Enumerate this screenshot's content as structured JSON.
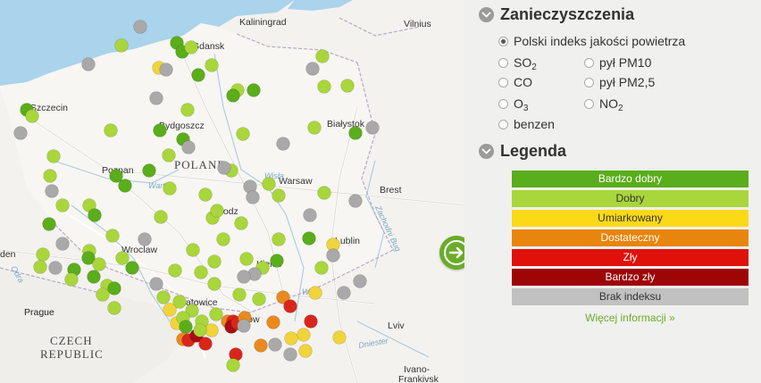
{
  "map": {
    "labels": {
      "kaliningrad": "Kaliningrad",
      "vilnius": "Vilnius",
      "gdansk": "Gdansk",
      "szczecin": "Szczecin",
      "bydgoszcz": "Bydgoszcz",
      "bialystok": "Białystok",
      "poland": "POLAND",
      "poznan": "Poznan",
      "warsaw": "Warsaw",
      "brest": "Brest",
      "lodz": "Lodz",
      "wroclaw": "Wroclaw",
      "lublin": "Lublin",
      "kielce": "Kielce",
      "katowice": "Katowice",
      "krakow": "Cracow",
      "prague": "Prague",
      "czech1": "CZECH",
      "czech2": "REPUBLIC",
      "lviv": "Lviv",
      "ivano": "Ivano-",
      "frankivsk": "Frankivsk",
      "den": "den",
      "warta": "Warta",
      "wisla1": "Wisła",
      "wisla2": "Wisła",
      "bug": "Zachodni Bug",
      "odra": "Odra",
      "dniester": "Dniester"
    },
    "station_colors": {
      "very_good": "#5aad1b",
      "good": "#a9d63a",
      "moderate": "#f0d43a",
      "sufficient": "#e88a1e",
      "bad": "#d9261c",
      "very_bad": "#a80d12",
      "none": "#a9a9a9"
    }
  },
  "panel": {
    "pollutants_title": "Zanieczyszczenia",
    "options": {
      "index": "Polski indeks jakości powietrza",
      "so2": "SO",
      "so2_sub": "2",
      "pm10": "pył PM10",
      "co": "CO",
      "pm25": "pył PM2,5",
      "o3": "O",
      "o3_sub": "3",
      "no2": "NO",
      "no2_sub": "2",
      "benzene": "benzen"
    },
    "legend_title": "Legenda",
    "legend": [
      {
        "label": "Bardzo dobry",
        "color": "#5aad1b",
        "text": "#ffffff"
      },
      {
        "label": "Dobry",
        "color": "#a9d63a",
        "text": "#333333"
      },
      {
        "label": "Umiarkowany",
        "color": "#fbd917",
        "text": "#333333"
      },
      {
        "label": "Dostateczny",
        "color": "#e8850c",
        "text": "#ffffff"
      },
      {
        "label": "Zły",
        "color": "#e0100a",
        "text": "#ffffff"
      },
      {
        "label": "Bardzo zły",
        "color": "#9e0505",
        "text": "#ffffff"
      },
      {
        "label": "Brak indeksu",
        "color": "#c1c1c1",
        "text": "#333333"
      }
    ],
    "more_link": "Więcej informacji »"
  }
}
